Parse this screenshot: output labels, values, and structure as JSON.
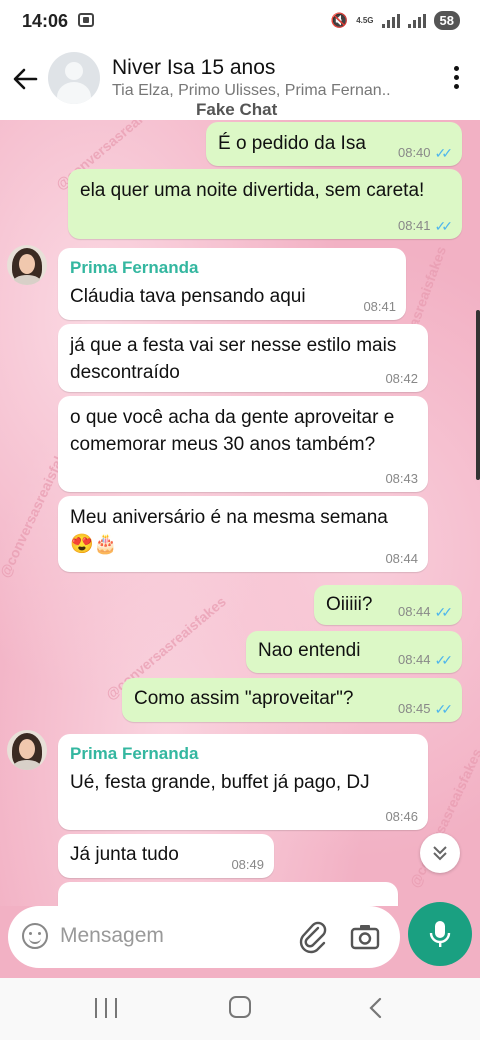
{
  "status_bar": {
    "time": "14:06",
    "network": "4.5G",
    "battery": "58"
  },
  "header": {
    "title": "Niver Isa 15 anos",
    "members": "Tia Elza, Primo Ulisses, Prima Fernan..",
    "watermark_label": "Fake Chat"
  },
  "watermark": "@conversasreaisfakes",
  "messages": [
    {
      "dir": "out",
      "text": "É o pedido da Isa",
      "time": "08:40"
    },
    {
      "dir": "out",
      "text": "ela quer uma noite divertida, sem careta!",
      "time": "08:41"
    },
    {
      "dir": "in",
      "sender": "Prima Fernanda",
      "text": "Cláudia tava pensando aqui",
      "time": "08:41"
    },
    {
      "dir": "in",
      "text": "já que a festa vai ser nesse estilo mais descontraído",
      "time": "08:42"
    },
    {
      "dir": "in",
      "text": "o que você acha da gente aproveitar e comemorar meus 30 anos também?",
      "time": "08:43"
    },
    {
      "dir": "in",
      "text": "Meu aniversário é na mesma semana 😍🎂",
      "time": "08:44"
    },
    {
      "dir": "out",
      "text": "Oiiiii?",
      "time": "08:44"
    },
    {
      "dir": "out",
      "text": "Nao entendi",
      "time": "08:44"
    },
    {
      "dir": "out",
      "text": "Como assim \"aproveitar\"?",
      "time": "08:45"
    },
    {
      "dir": "in",
      "sender": "Prima Fernanda",
      "text": "Ué, festa grande, buffet já pago, DJ",
      "time": "08:46"
    },
    {
      "dir": "in",
      "text": "Já junta tudo",
      "time": "08:49"
    }
  ],
  "input": {
    "placeholder": "Mensagem"
  },
  "colors": {
    "outgoing_bubble": "#dcf8c6",
    "incoming_bubble": "#ffffff",
    "chat_background": "#f2b1c4",
    "sender_name": "#34b7a0",
    "read_ticks": "#4fb6ec",
    "mic_button": "#1aa081"
  },
  "icons": [
    "back-arrow-icon",
    "group-avatar-icon",
    "more-vert-icon",
    "double-check-icon",
    "chevron-double-down-icon",
    "emoji-icon",
    "attach-icon",
    "camera-icon",
    "mic-icon"
  ]
}
